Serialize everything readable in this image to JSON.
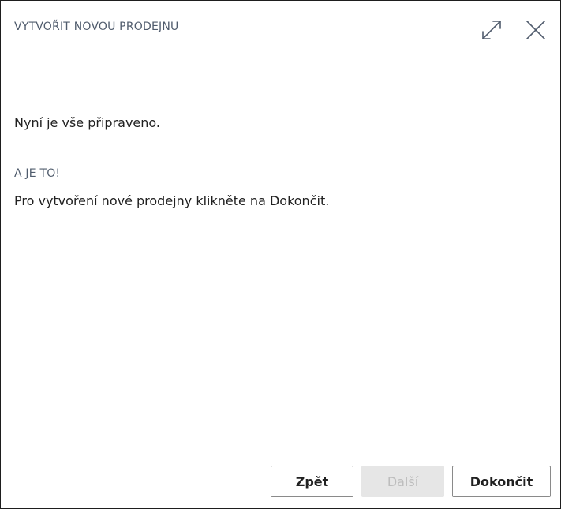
{
  "dialog": {
    "title": "VYTVOŘIT NOVOU PRODEJNU",
    "icons": {
      "expand": "expand-icon",
      "close": "close-icon"
    }
  },
  "content": {
    "ready_text": "Nyní je vše připraveno.",
    "heading": "A JE TO!",
    "instruction": "Pro vytvoření nové prodejny klikněte na Dokončit."
  },
  "footer": {
    "back_label": "Zpět",
    "next_label": "Další",
    "finish_label": "Dokončit",
    "next_disabled": true
  },
  "colors": {
    "title": "#505c6d",
    "text": "#212121",
    "disabled_bg": "#e6e6e6",
    "disabled_text": "#bdbdbd"
  }
}
